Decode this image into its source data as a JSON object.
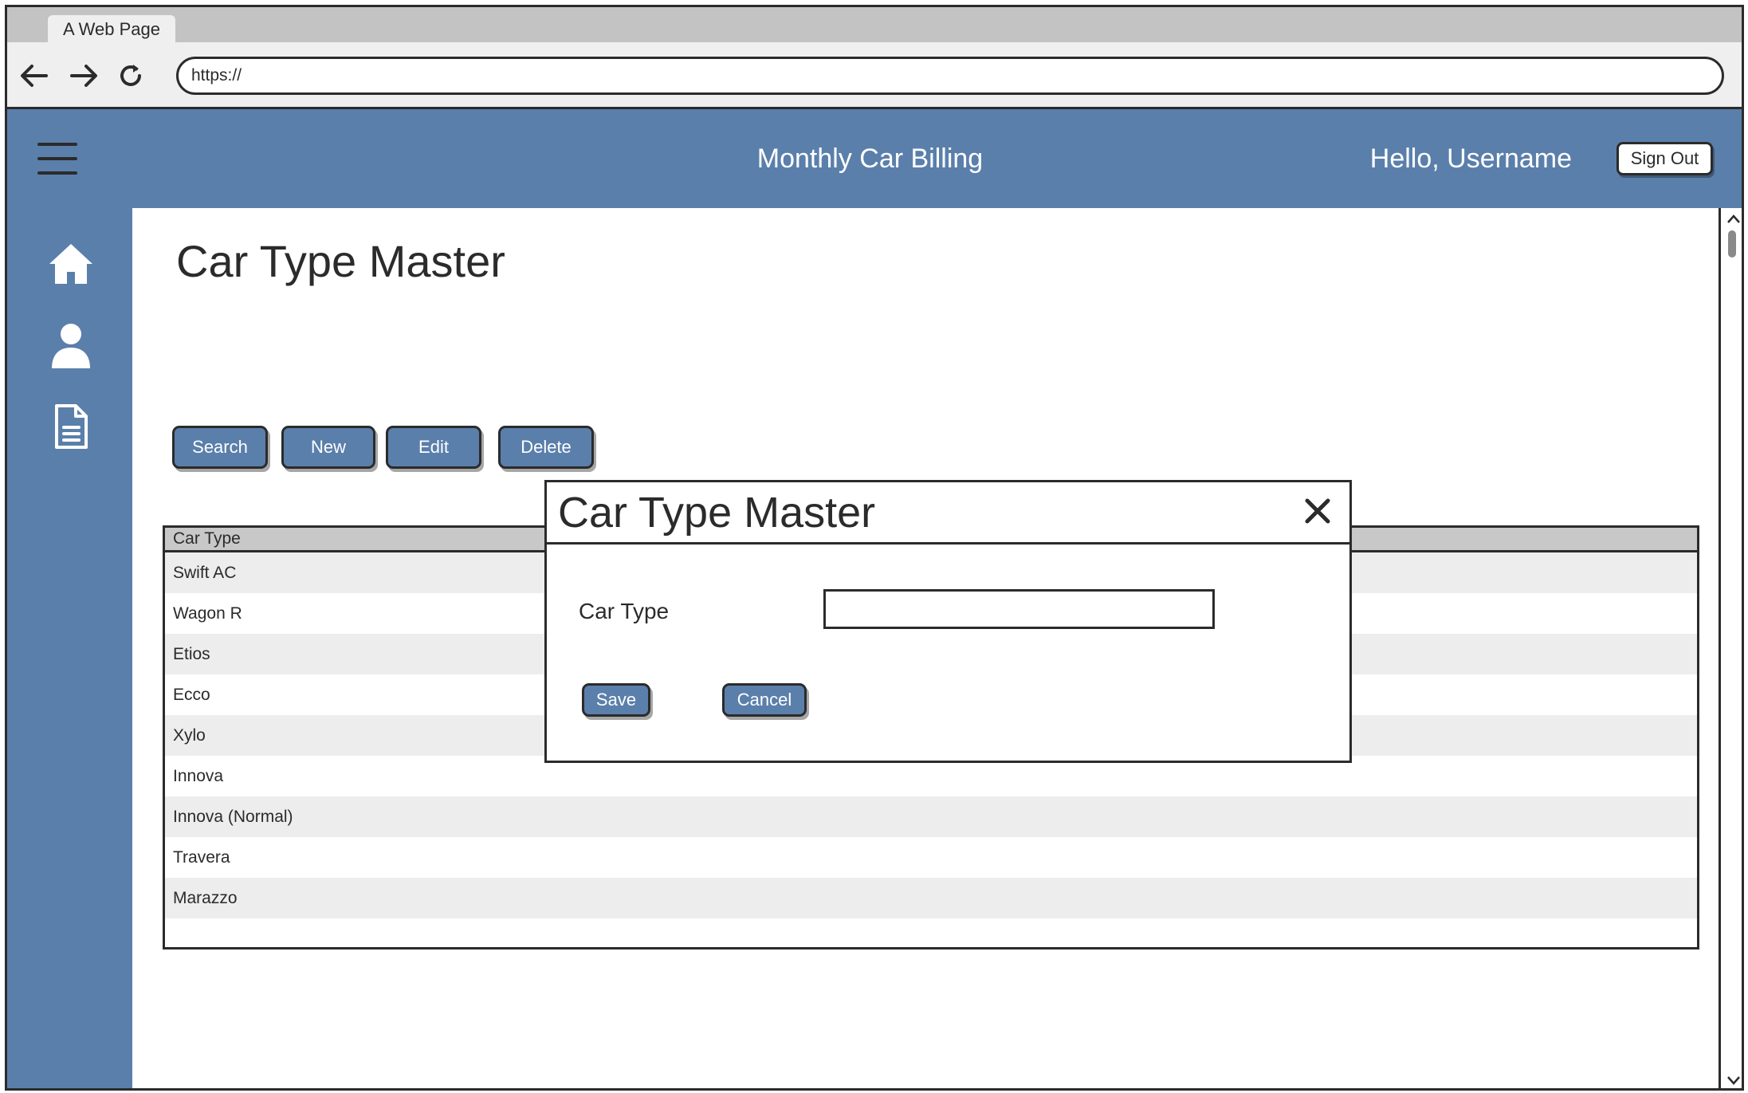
{
  "browser": {
    "tab_title": "A Web Page",
    "url": "https://",
    "icons": [
      "back-arrow-icon",
      "forward-arrow-icon",
      "reload-icon"
    ]
  },
  "header": {
    "menu_icon": "hamburger-menu-icon",
    "app_title": "Monthly Car Billing",
    "greeting": "Hello, Username",
    "sign_out_label": "Sign Out"
  },
  "sidebar": {
    "items": [
      {
        "icon": "home-icon"
      },
      {
        "icon": "user-icon"
      },
      {
        "icon": "document-icon"
      }
    ]
  },
  "page": {
    "title": "Car Type Master",
    "toolbar": {
      "search_label": "Search",
      "new_label": "New",
      "edit_label": "Edit",
      "delete_label": "Delete"
    }
  },
  "grid": {
    "column_header": "Car Type",
    "rows": [
      "Swift AC",
      "Wagon R",
      "Etios",
      "Ecco",
      "Xylo",
      "Innova",
      "Innova (Normal)",
      "Travera",
      "Marazzo"
    ]
  },
  "modal": {
    "title": "Car Type Master",
    "close_icon": "close-icon",
    "field_label": "Car Type",
    "field_value": "",
    "save_label": "Save",
    "cancel_label": "Cancel"
  },
  "colors": {
    "brand": "#5a7fab",
    "border": "#2b2b2b",
    "row_alt": "#ededed",
    "header_gray": "#c8c8c8"
  }
}
